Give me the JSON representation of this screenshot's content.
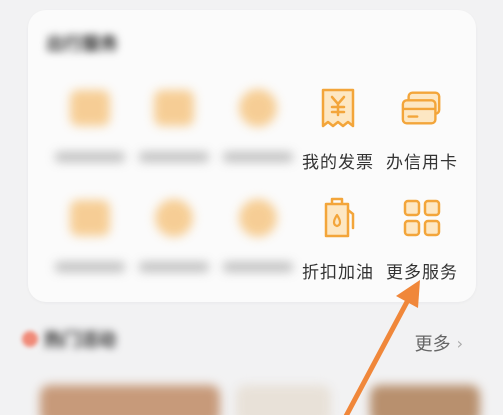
{
  "card": {
    "title": "出行服务",
    "items": [
      {
        "label": "",
        "icon": "blurred-icon",
        "blurred": true
      },
      {
        "label": "",
        "icon": "blurred-icon",
        "blurred": true
      },
      {
        "label": "",
        "icon": "blurred-icon",
        "blurred": true
      },
      {
        "label": "我的发票",
        "icon": "invoice-icon",
        "blurred": false
      },
      {
        "label": "办信用卡",
        "icon": "credit-card-icon",
        "blurred": false
      },
      {
        "label": "",
        "icon": "blurred-icon",
        "blurred": true
      },
      {
        "label": "",
        "icon": "blurred-icon",
        "blurred": true
      },
      {
        "label": "",
        "icon": "blurred-icon",
        "blurred": true
      },
      {
        "label": "折扣加油",
        "icon": "fuel-icon",
        "blurred": false
      },
      {
        "label": "更多服务",
        "icon": "more-grid-icon",
        "blurred": false
      }
    ]
  },
  "section": {
    "title": "热门活动",
    "more_label": "更多",
    "more_icon": "chevron-right-icon"
  },
  "colors": {
    "icon_orange": "#f3a53a",
    "icon_fill": "#fde7c3",
    "arrow": "#f0873a"
  }
}
